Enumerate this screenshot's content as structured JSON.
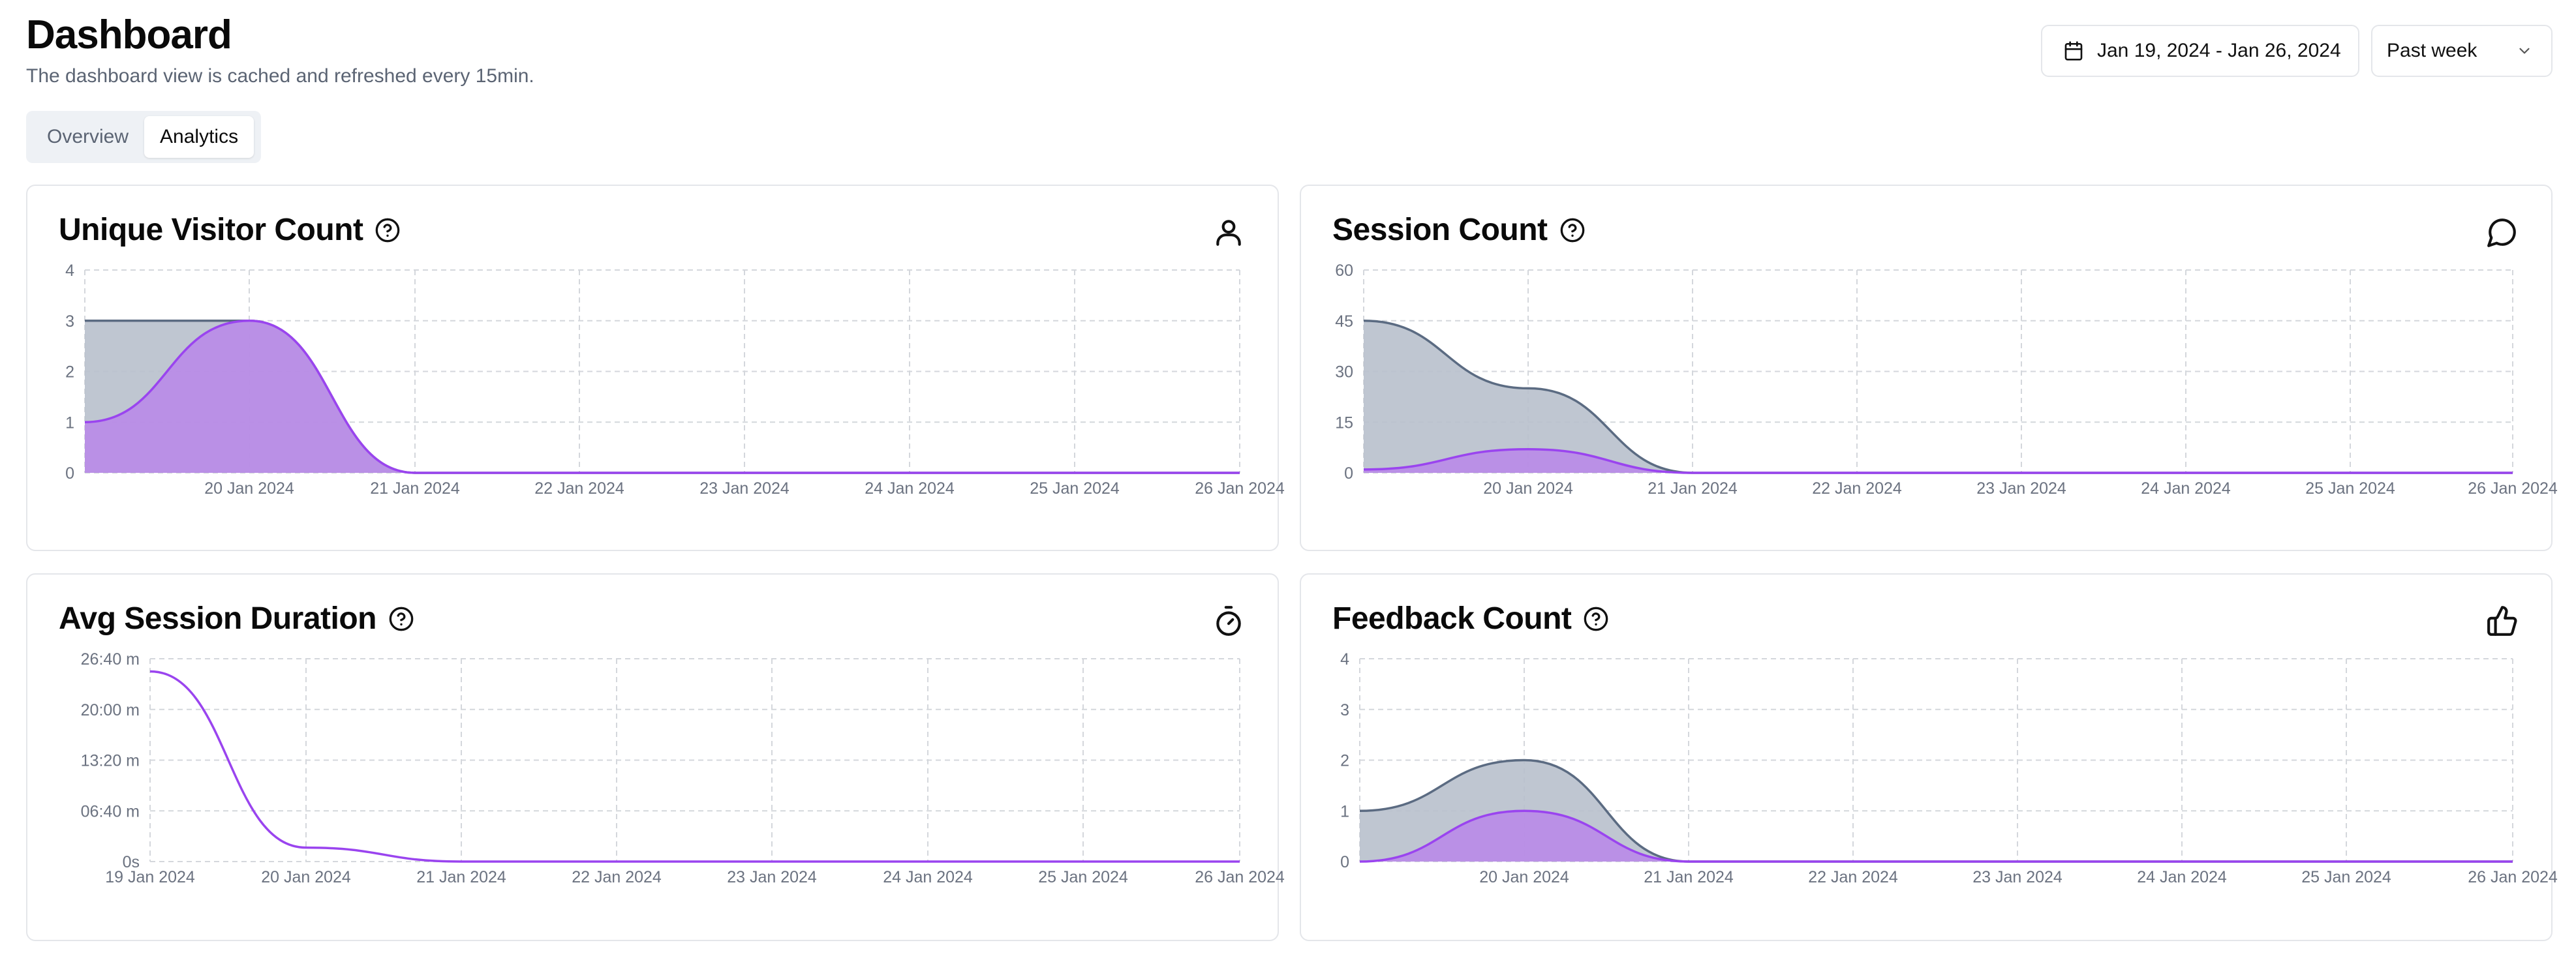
{
  "header": {
    "title": "Dashboard",
    "subtitle": "The dashboard view is cached and refreshed every 15min."
  },
  "controls": {
    "date_range": "Jan 19, 2024 - Jan 26, 2024",
    "period": "Past week",
    "calendar_icon": "calendar-icon",
    "chevron_icon": "chevron-down-icon"
  },
  "tabs": [
    {
      "label": "Overview",
      "active": false
    },
    {
      "label": "Analytics",
      "active": true
    }
  ],
  "colors": {
    "gray_stroke": "#5b6b82",
    "gray_fill": "#b8c0cc",
    "purple_stroke": "#9a44ef",
    "purple_fill": "#b98ae8",
    "grid": "#d4d7dc"
  },
  "cards": [
    {
      "title": "Unique Visitor Count",
      "icon": "user-icon"
    },
    {
      "title": "Session Count",
      "icon": "message-circle-icon"
    },
    {
      "title": "Avg Session Duration",
      "icon": "timer-icon"
    },
    {
      "title": "Feedback Count",
      "icon": "thumbs-up-icon"
    }
  ],
  "chart_data": [
    {
      "type": "area",
      "title": "Unique Visitor Count",
      "x": [
        "19 Jan 2024",
        "20 Jan 2024",
        "21 Jan 2024",
        "22 Jan 2024",
        "23 Jan 2024",
        "24 Jan 2024",
        "25 Jan 2024",
        "26 Jan 2024"
      ],
      "x_tick_labels": [
        "",
        "20 Jan 2024",
        "21 Jan 2024",
        "22 Jan 2024",
        "23 Jan 2024",
        "24 Jan 2024",
        "25 Jan 2024",
        "26 Jan 2024"
      ],
      "y_ticks": [
        "0",
        "1",
        "2",
        "3",
        "4"
      ],
      "ylim": [
        0,
        4
      ],
      "grid": true,
      "series": [
        {
          "color": "gray",
          "values": [
            3,
            3,
            0,
            0,
            0,
            0,
            0,
            0
          ]
        },
        {
          "color": "purple",
          "values": [
            1,
            3,
            0,
            0,
            0,
            0,
            0,
            0
          ]
        }
      ]
    },
    {
      "type": "area",
      "title": "Session Count",
      "x": [
        "19 Jan 2024",
        "20 Jan 2024",
        "21 Jan 2024",
        "22 Jan 2024",
        "23 Jan 2024",
        "24 Jan 2024",
        "25 Jan 2024",
        "26 Jan 2024"
      ],
      "x_tick_labels": [
        "",
        "20 Jan 2024",
        "21 Jan 2024",
        "22 Jan 2024",
        "23 Jan 2024",
        "24 Jan 2024",
        "25 Jan 2024",
        "26 Jan 2024"
      ],
      "y_ticks": [
        "0",
        "15",
        "30",
        "45",
        "60"
      ],
      "ylim": [
        0,
        60
      ],
      "grid": true,
      "series": [
        {
          "color": "gray",
          "values": [
            45,
            25,
            0,
            0,
            0,
            0,
            0,
            0
          ]
        },
        {
          "color": "purple",
          "values": [
            1,
            7,
            0,
            0,
            0,
            0,
            0,
            0
          ]
        }
      ]
    },
    {
      "type": "line",
      "title": "Avg Session Duration",
      "x": [
        "19 Jan 2024",
        "20 Jan 2024",
        "21 Jan 2024",
        "22 Jan 2024",
        "23 Jan 2024",
        "24 Jan 2024",
        "25 Jan 2024",
        "26 Jan 2024"
      ],
      "x_tick_labels": [
        "19 Jan 2024",
        "20 Jan 2024",
        "21 Jan 2024",
        "22 Jan 2024",
        "23 Jan 2024",
        "24 Jan 2024",
        "25 Jan 2024",
        "26 Jan 2024"
      ],
      "y_ticks": [
        "0s",
        "06:40 m",
        "13:20 m",
        "20:00 m",
        "26:40 m"
      ],
      "ylim": [
        0,
        1600
      ],
      "grid": true,
      "series": [
        {
          "color": "purple",
          "values": [
            1500,
            110,
            0,
            0,
            0,
            0,
            0,
            0
          ]
        }
      ]
    },
    {
      "type": "area",
      "title": "Feedback Count",
      "x": [
        "19 Jan 2024",
        "20 Jan 2024",
        "21 Jan 2024",
        "22 Jan 2024",
        "23 Jan 2024",
        "24 Jan 2024",
        "25 Jan 2024",
        "26 Jan 2024"
      ],
      "x_tick_labels": [
        "",
        "20 Jan 2024",
        "21 Jan 2024",
        "22 Jan 2024",
        "23 Jan 2024",
        "24 Jan 2024",
        "25 Jan 2024",
        "26 Jan 2024"
      ],
      "y_ticks": [
        "0",
        "1",
        "2",
        "3",
        "4"
      ],
      "ylim": [
        0,
        4
      ],
      "grid": true,
      "series": [
        {
          "color": "gray",
          "values": [
            1,
            2,
            0,
            0,
            0,
            0,
            0,
            0
          ]
        },
        {
          "color": "purple",
          "values": [
            0,
            1,
            0,
            0,
            0,
            0,
            0,
            0
          ]
        }
      ]
    }
  ]
}
